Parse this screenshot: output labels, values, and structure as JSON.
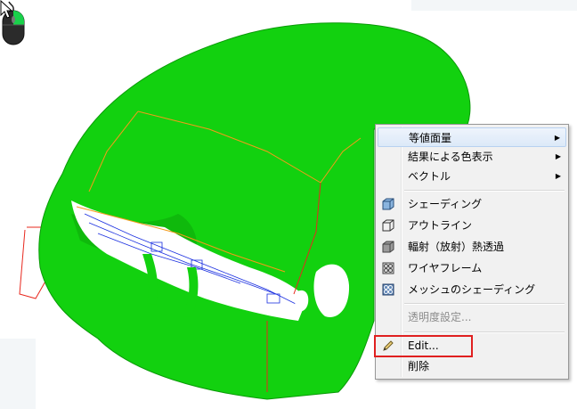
{
  "context_menu": {
    "items": [
      {
        "label": "等値面量",
        "submenu": true
      },
      {
        "label": "結果による色表示",
        "submenu": true
      },
      {
        "label": "ベクトル",
        "submenu": true
      },
      {
        "label": "シェーディング",
        "icon": "shaded-cube-icon"
      },
      {
        "label": "アウトライン",
        "icon": "outline-cube-icon"
      },
      {
        "label": "輻射（放射）熱透過",
        "icon": "radiation-cube-icon"
      },
      {
        "label": "ワイヤフレーム",
        "icon": "wireframe-cube-icon"
      },
      {
        "label": "メッシュのシェーディング",
        "icon": "mesh-shaded-cube-icon"
      },
      {
        "label": "透明度設定...",
        "disabled": true
      },
      {
        "label": "Edit...",
        "icon": "pencil-icon",
        "highlighted": true
      },
      {
        "label": "削除"
      }
    ]
  },
  "colors": {
    "model_green": "#12d10f",
    "highlight_box": "#e02020",
    "menu_background": "#f1f1f1"
  },
  "icons": [
    "mouse-icon",
    "arrow-cursor-icon"
  ]
}
